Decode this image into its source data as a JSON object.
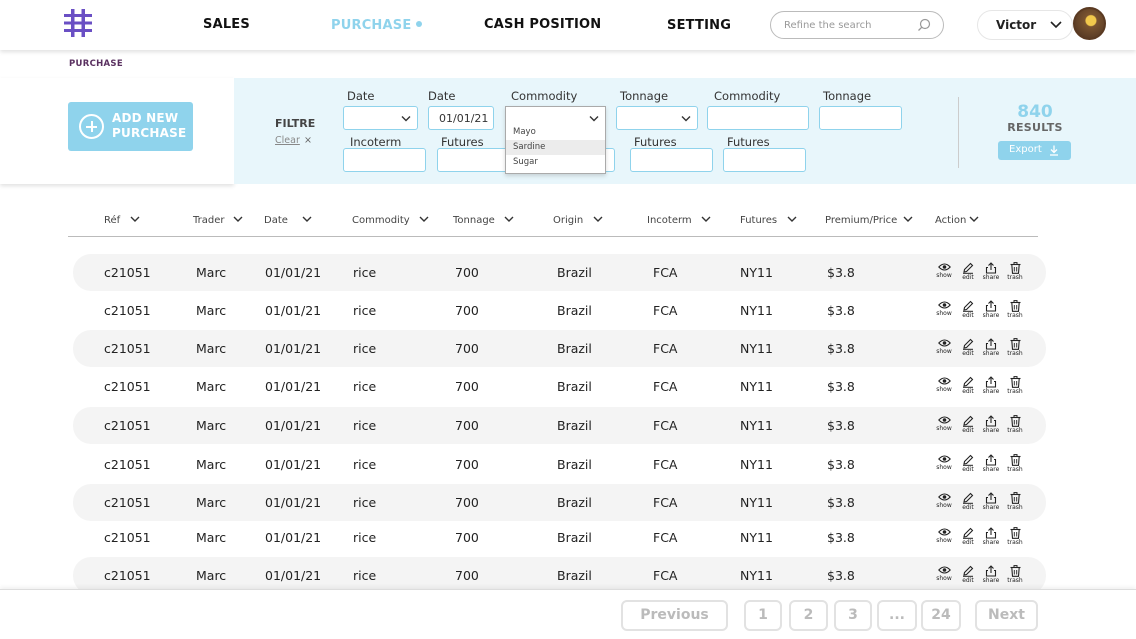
{
  "nav": {
    "items": [
      {
        "label": "SALES"
      },
      {
        "label": "PURCHASE"
      },
      {
        "label": "CASH POSITION"
      },
      {
        "label": "SETTING"
      }
    ],
    "search_placeholder": "Refine the search",
    "user_name": "Victor"
  },
  "breadcrumb": "PURCHASE",
  "add_button": {
    "line1": "ADD NEW",
    "line2": "PURCHASE"
  },
  "filter": {
    "title": "FILTRE",
    "clear_label": "Clear",
    "clear_icon": "×",
    "fields": [
      {
        "label": "Date",
        "value": ""
      },
      {
        "label": "Date",
        "value": "01/01/21"
      },
      {
        "label": "Commodity",
        "value": ""
      },
      {
        "label": "Tonnage",
        "value": ""
      },
      {
        "label": "Commodity",
        "value": ""
      },
      {
        "label": "Tonnage",
        "value": ""
      },
      {
        "label": "Incoterm",
        "value": ""
      },
      {
        "label": "Futures",
        "value": ""
      },
      {
        "label": "Futures",
        "value": ""
      },
      {
        "label": "Futures",
        "value": ""
      }
    ],
    "dropdown_options": [
      "Mayo",
      "Sardine",
      "Sugar"
    ],
    "dropdown_highlight": "Sardine"
  },
  "results": {
    "count": "840",
    "label": "RESULTS",
    "export_label": "Export"
  },
  "table": {
    "columns": [
      "Réf",
      "Trader",
      "Date",
      "Commodity",
      "Tonnage",
      "Origin",
      "Incoterm",
      "Futures",
      "Premium/Price",
      "Action"
    ],
    "actions": [
      "show",
      "edit",
      "share",
      "trash"
    ],
    "rows": [
      [
        "c21051",
        "Marc",
        "01/01/21",
        "rice",
        "700",
        "Brazil",
        "FCA",
        "NY11",
        "$3.8"
      ],
      [
        "c21051",
        "Marc",
        "01/01/21",
        "rice",
        "700",
        "Brazil",
        "FCA",
        "NY11",
        "$3.8"
      ],
      [
        "c21051",
        "Marc",
        "01/01/21",
        "rice",
        "700",
        "Brazil",
        "FCA",
        "NY11",
        "$3.8"
      ],
      [
        "c21051",
        "Marc",
        "01/01/21",
        "rice",
        "700",
        "Brazil",
        "FCA",
        "NY11",
        "$3.8"
      ],
      [
        "c21051",
        "Marc",
        "01/01/21",
        "rice",
        "700",
        "Brazil",
        "FCA",
        "NY11",
        "$3.8"
      ],
      [
        "c21051",
        "Marc",
        "01/01/21",
        "rice",
        "700",
        "Brazil",
        "FCA",
        "NY11",
        "$3.8"
      ],
      [
        "c21051",
        "Marc",
        "01/01/21",
        "rice",
        "700",
        "Brazil",
        "FCA",
        "NY11",
        "$3.8"
      ],
      [
        "c21051",
        "Marc",
        "01/01/21",
        "rice",
        "700",
        "Brazil",
        "FCA",
        "NY11",
        "$3.8"
      ],
      [
        "c21051",
        "Marc",
        "01/01/21",
        "rice",
        "700",
        "Brazil",
        "FCA",
        "NY11",
        "$3.8"
      ]
    ]
  },
  "pagination": {
    "previous": "Previous",
    "pages": [
      "1",
      "2",
      "3",
      "...",
      "24"
    ],
    "next": "Next"
  },
  "colors": {
    "accent": "#8fd3ec",
    "logo": "#6a4fc4",
    "filter_bg": "#e8f6fb"
  }
}
